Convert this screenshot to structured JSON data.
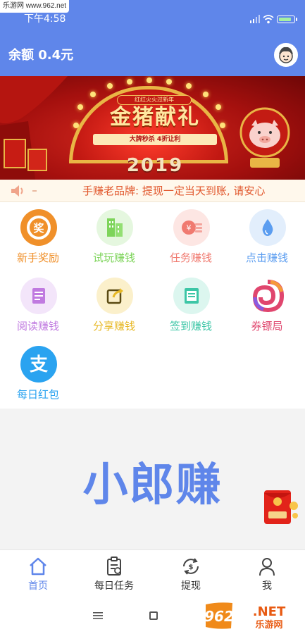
{
  "status_bar": {
    "watermark": "乐游网 www.962.net",
    "time": "下午4:58"
  },
  "header": {
    "balance": "余额 0.4元",
    "avatar_icon": "user-avatar-icon"
  },
  "banner": {
    "badge": "红红火火过新年",
    "title": "金猪献礼",
    "strip": "大牌秒杀 4折让利",
    "year": "2019"
  },
  "notice": {
    "icon": "speaker-icon",
    "text": "手赚老品牌: 提现一定当天到账, 请安心"
  },
  "grid": {
    "items": [
      {
        "label": "新手奖励",
        "color": "#f0902a",
        "icon": "reward-icon"
      },
      {
        "label": "试玩赚钱",
        "color": "#7dd45a",
        "icon": "buildings-icon"
      },
      {
        "label": "任务赚钱",
        "color": "#f07a70",
        "icon": "task-money-icon"
      },
      {
        "label": "点击赚钱",
        "color": "#5b9df0",
        "icon": "drop-icon"
      },
      {
        "label": "阅读赚钱",
        "color": "#c07ae0",
        "icon": "document-icon"
      },
      {
        "label": "分享赚钱",
        "color": "#e7b824",
        "icon": "share-icon"
      },
      {
        "label": "签到赚钱",
        "color": "#3cc6a6",
        "icon": "checkin-icon"
      },
      {
        "label": "券镖局",
        "color": "#e0466e",
        "icon": "coupon-swirl-icon"
      },
      {
        "label": "每日红包",
        "color": "#2aa3f0",
        "icon": "alipay-icon"
      }
    ]
  },
  "brand": {
    "name": "小郎赚",
    "red_packet_icon": "red-packet-icon"
  },
  "tabs": [
    {
      "label": "首页",
      "icon": "home-icon",
      "active": true
    },
    {
      "label": "每日任务",
      "icon": "clipboard-icon",
      "active": false
    },
    {
      "label": "提现",
      "icon": "withdraw-icon",
      "active": false
    },
    {
      "label": "我",
      "icon": "person-icon",
      "active": false
    }
  ],
  "colors": {
    "primary": "#5f86ea",
    "notice_text": "#e1562b"
  }
}
